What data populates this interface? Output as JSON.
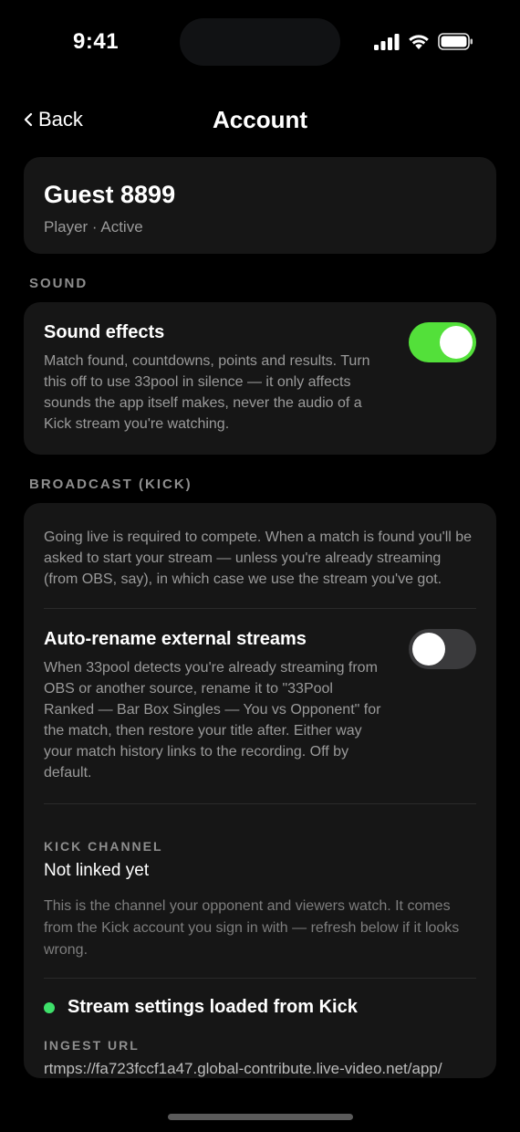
{
  "status_bar": {
    "time": "9:41"
  },
  "nav": {
    "back_label": "Back",
    "title": "Account"
  },
  "profile": {
    "name": "Guest 8899",
    "subtitle": "Player · Active"
  },
  "sound": {
    "section_label": "SOUND",
    "title": "Sound effects",
    "description": "Match found, countdowns, points and results. Turn this off to use 33pool in silence — it only affects sounds the app itself makes, never the audio of a Kick stream you're watching.",
    "enabled": true
  },
  "broadcast": {
    "section_label": "BROADCAST (KICK)",
    "intro": "Going live is required to compete. When a match is found you'll be asked to start your stream — unless you're already streaming (from OBS, say), in which case we use the stream you've got.",
    "auto_rename": {
      "title": "Auto-rename external streams",
      "description": "When 33pool detects you're already streaming from OBS or another source, rename it to \"33Pool Ranked — Bar Box Singles — You vs Opponent\" for the match, then restore your title after. Either way your match history links to the recording. Off by default.",
      "enabled": false
    },
    "kick_channel": {
      "label": "KICK CHANNEL",
      "value": "Not linked yet",
      "description": "This is the channel your opponent and viewers watch. It comes from the Kick account you sign in with — refresh below if it looks wrong."
    },
    "status": {
      "text": "Stream settings loaded from Kick",
      "color": "#3ee06a"
    },
    "ingest": {
      "label": "INGEST URL",
      "value": "rtmps://fa723fccf1a47.global-contribute.live-video.net/app/"
    }
  },
  "colors": {
    "toggle_on": "#53e03a",
    "card_bg": "#161616",
    "background": "#000000"
  }
}
